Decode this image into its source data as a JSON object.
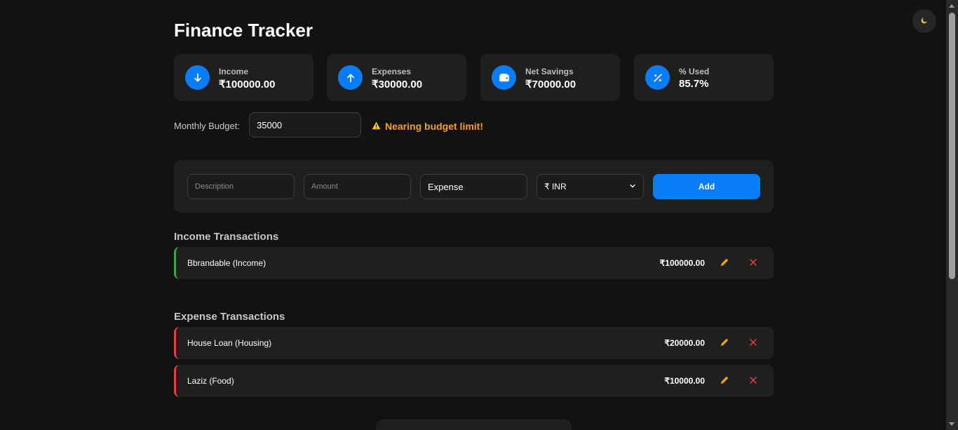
{
  "app": {
    "title": "Finance Tracker",
    "theme_toggle_icon": "moon-icon"
  },
  "summary": [
    {
      "label": "Income",
      "value": "₹100000.00",
      "icon": "arrow-down-icon"
    },
    {
      "label": "Expenses",
      "value": "₹30000.00",
      "icon": "arrow-up-icon"
    },
    {
      "label": "Net Savings",
      "value": "₹70000.00",
      "icon": "wallet-icon"
    },
    {
      "label": "% Used",
      "value": "85.7%",
      "icon": "percent-icon"
    }
  ],
  "budget": {
    "label": "Monthly Budget:",
    "value": "35000",
    "warning": "Nearing budget limit!",
    "warning_icon": "warning-icon",
    "warning_color": "#f5a11c"
  },
  "form": {
    "description_placeholder": "Description",
    "amount_placeholder": "Amount",
    "type_value": "Expense",
    "currency_value": "₹ INR",
    "add_label": "Add"
  },
  "income_section": {
    "title": "Income Transactions",
    "items": [
      {
        "description": "Bbrandable (Income)",
        "amount": "₹100000.00"
      }
    ]
  },
  "expense_section": {
    "title": "Expense Transactions",
    "items": [
      {
        "description": "House Loan (Housing)",
        "amount": "₹20000.00"
      },
      {
        "description": "Laziz (Food)",
        "amount": "₹10000.00"
      }
    ]
  },
  "colors": {
    "accent": "#0a7cf5",
    "income_border": "#39a844",
    "expense_border": "#e0453a",
    "edit_icon": "#f5a11c",
    "delete_icon": "#e0453a",
    "background": "#121212",
    "card": "#1f1f1f"
  }
}
